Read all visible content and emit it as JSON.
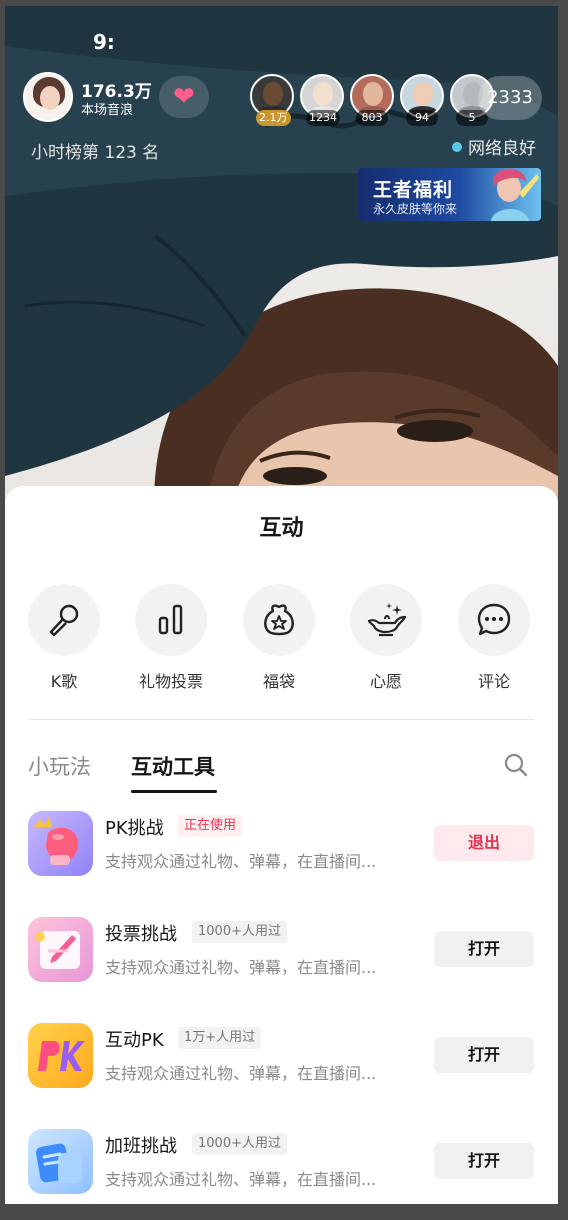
{
  "status": {
    "time": "9:"
  },
  "host": {
    "count": "176.3万",
    "subtitle": "本场音浪"
  },
  "viewers": [
    {
      "badge": "2.1万",
      "skin": "#6b4a34",
      "shirt": "#2b2b2b",
      "bg": "#3a3a3a"
    },
    {
      "badge": "1234",
      "skin": "#f2e0cf",
      "shirt": "#e7e7e7",
      "bg": "#d5d5d5"
    },
    {
      "badge": "803",
      "skin": "#e3b79c",
      "shirt": "#9b5c52",
      "bg": "#b56b5c"
    },
    {
      "badge": "94",
      "skin": "#f0cdb7",
      "shirt": "#2f2f2f",
      "bg": "#c9d7e0"
    },
    {
      "badge": "5",
      "skin": "#b5b9bd",
      "shirt": "#8d9196",
      "bg": "#c4c8cc"
    }
  ],
  "viewer_total": "2333",
  "rank_text": "小时榜第 123 名",
  "network_status": "网络良好",
  "promo": {
    "title": "王者福利",
    "subtitle": "永久皮肤等你来"
  },
  "sheet": {
    "title": "互动",
    "features": [
      {
        "label": "K歌",
        "icon": "microphone-icon"
      },
      {
        "label": "礼物投票",
        "icon": "bar-chart-icon"
      },
      {
        "label": "福袋",
        "icon": "lucky-bag-icon"
      },
      {
        "label": "心愿",
        "icon": "magic-lamp-icon"
      },
      {
        "label": "评论",
        "icon": "comment-icon"
      }
    ],
    "tabs": {
      "inactive": "小玩法",
      "active": "互动工具"
    },
    "tools": [
      {
        "name": "PK挑战",
        "tag": "正在使用",
        "desc": "支持观众通过礼物、弹幕，在直播间...",
        "button": "退出",
        "state": "active"
      },
      {
        "name": "投票挑战",
        "tag": "1000+人用过",
        "desc": "支持观众通过礼物、弹幕，在直播间...",
        "button": "打开",
        "state": "normal"
      },
      {
        "name": "互动PK",
        "tag": "1万+人用过",
        "desc": "支持观众通过礼物、弹幕，在直播间...",
        "button": "打开",
        "state": "normal"
      },
      {
        "name": "加班挑战",
        "tag": "1000+人用过",
        "desc": "支持观众通过礼物、弹幕，在直播间...",
        "button": "打开",
        "state": "normal"
      }
    ]
  },
  "colors": {
    "accent_red": "#e8334f",
    "network_dot": "#5cc9e6",
    "promo_blue": "#1e4aa1"
  }
}
